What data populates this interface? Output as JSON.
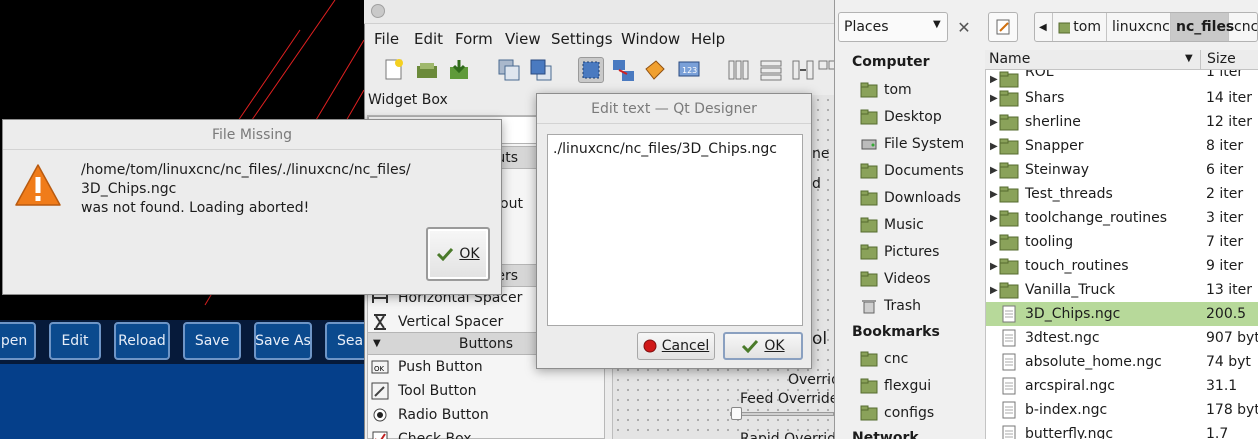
{
  "cnc": {
    "buttons": [
      {
        "label": "pen"
      },
      {
        "label": "Edit"
      },
      {
        "label": "Reload"
      },
      {
        "label": "Save"
      },
      {
        "label": "Save As"
      },
      {
        "label": "Sear"
      }
    ]
  },
  "designer": {
    "menu": [
      "File",
      "Edit",
      "Form",
      "View",
      "Settings",
      "Window",
      "Help"
    ],
    "widget_box_title": "Widget Box",
    "panel_partial": "ow",
    "widget_fragments": {
      "layouts_tail": "uts",
      "layout_item_tail": "out",
      "spacers_tail": "ers"
    },
    "widgets": [
      {
        "label": "Horizontal Spacer",
        "icon": "horizontal-spacer-icon"
      },
      {
        "label": "Vertical Spacer",
        "icon": "vertical-spacer-icon"
      }
    ],
    "buttons_category": "Buttons",
    "button_widgets": [
      {
        "label": "Push Button",
        "icon": "push-button-icon"
      },
      {
        "label": "Tool Button",
        "icon": "tool-button-icon"
      },
      {
        "label": "Radio Button",
        "icon": "radio-button-icon"
      },
      {
        "label": "Check Box",
        "icon": "check-box-icon"
      }
    ],
    "form_fragments": {
      "ne": "ne",
      "d": "d",
      "ol": "ol",
      "overrid": "Overrid",
      "feed_override": "Feed Override",
      "rapid_override": "Rapid Overrid"
    }
  },
  "file_missing": {
    "title": "File Missing",
    "message_line1": "/home/tom/linuxcnc/nc_files/./linuxcnc/nc_files/",
    "message_line2": "3D_Chips.ngc",
    "message_line3": "was not found. Loading aborted!",
    "ok_label": "OK"
  },
  "edit_text": {
    "title": "Edit text — Qt Designer",
    "content": "./linuxcnc/nc_files/3D_Chips.ngc",
    "cancel_label": "Cancel",
    "ok_label": "OK"
  },
  "file_manager": {
    "places_label": "Places",
    "sections": {
      "computer": "Computer",
      "bookmarks": "Bookmarks",
      "network": "Network"
    },
    "computer_items": [
      "tom",
      "Desktop",
      "File System",
      "Documents",
      "Downloads",
      "Music",
      "Pictures",
      "Videos",
      "Trash"
    ],
    "bookmark_items": [
      "cnc",
      "flexgui",
      "configs"
    ],
    "breadcrumbs": [
      "tom",
      "linuxcnc",
      "nc_files",
      "cnc_"
    ],
    "columns": {
      "name": "Name",
      "size": "Size"
    },
    "rows": [
      {
        "name": "ROL",
        "size": "1 iter",
        "type": "folder"
      },
      {
        "name": "Shars",
        "size": "14 iter",
        "type": "folder"
      },
      {
        "name": "sherline",
        "size": "12 iter",
        "type": "folder"
      },
      {
        "name": "Snapper",
        "size": "8 iter",
        "type": "folder"
      },
      {
        "name": "Steinway",
        "size": "6 iter",
        "type": "folder"
      },
      {
        "name": "Test_threads",
        "size": "2 iter",
        "type": "folder"
      },
      {
        "name": "toolchange_routines",
        "size": "3 iter",
        "type": "folder"
      },
      {
        "name": "tooling",
        "size": "7 iter",
        "type": "folder"
      },
      {
        "name": "touch_routines",
        "size": "9 iter",
        "type": "folder"
      },
      {
        "name": "Vanilla_Truck",
        "size": "13 iter",
        "type": "folder"
      },
      {
        "name": "3D_Chips.ngc",
        "size": "200.5",
        "type": "file",
        "selected": true
      },
      {
        "name": "3dtest.ngc",
        "size": "907 byt",
        "type": "file"
      },
      {
        "name": "absolute_home.ngc",
        "size": "74 byt",
        "type": "file"
      },
      {
        "name": "arcspiral.ngc",
        "size": "31.1",
        "type": "file"
      },
      {
        "name": "b-index.ngc",
        "size": "178 byt",
        "type": "file"
      },
      {
        "name": "butterfly.ngc",
        "size": "1.7",
        "type": "file"
      }
    ]
  },
  "colors": {
    "selected_row": "#b7d99a",
    "cnc_button_bg": "#0b4a8e",
    "cnc_panel": "#053f8a",
    "warning": "#f07c1a"
  }
}
